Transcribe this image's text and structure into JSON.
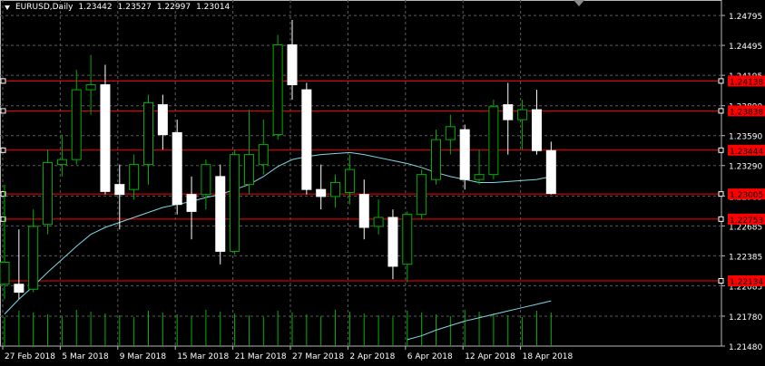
{
  "header": {
    "symbol": "EURUSD,Daily",
    "open": "1.23442",
    "high": "1.23527",
    "low": "1.22997",
    "close": "1.23014"
  },
  "colors": {
    "background": "#000000",
    "grid": "#5c5c5c",
    "candle_up": "#000000",
    "candle_down": "#ffffff",
    "candle_outline": "#00b000",
    "ma_line": "#7fd8e6",
    "level_line": "#ff0000",
    "level_label_bg": "#ff0000",
    "volume": "#00b400",
    "axis_text": "#ffffff"
  },
  "chart_data": {
    "type": "candlestick",
    "ylim": [
      1.2148,
      1.2495
    ],
    "y_ticks": [
      "1.24795",
      "1.24495",
      "1.24195",
      "1.23890",
      "1.23590",
      "1.23290",
      "1.22985",
      "1.22685",
      "1.22385",
      "1.22085",
      "1.21780",
      "1.21480"
    ],
    "x_tick_labels": [
      "27 Feb 2018",
      "5 Mar 2018",
      "9 Mar 2018",
      "15 Mar 2018",
      "21 Mar 2018",
      "27 Mar 2018",
      "2 Apr 2018",
      "6 Apr 2018",
      "12 Apr 2018",
      "18 Apr 2018"
    ],
    "candles": [
      {
        "o": 1.221,
        "h": 1.231,
        "l": 1.2195,
        "c": 1.2232
      },
      {
        "o": 1.221,
        "h": 1.2265,
        "l": 1.2195,
        "c": 1.2202
      },
      {
        "o": 1.2205,
        "h": 1.2285,
        "l": 1.2202,
        "c": 1.2268
      },
      {
        "o": 1.227,
        "h": 1.2345,
        "l": 1.226,
        "c": 1.2332
      },
      {
        "o": 1.233,
        "h": 1.236,
        "l": 1.2318,
        "c": 1.2335
      },
      {
        "o": 1.2335,
        "h": 1.2425,
        "l": 1.233,
        "c": 1.2405
      },
      {
        "o": 1.2405,
        "h": 1.244,
        "l": 1.238,
        "c": 1.241
      },
      {
        "o": 1.241,
        "h": 1.243,
        "l": 1.23,
        "c": 1.2303
      },
      {
        "o": 1.231,
        "h": 1.233,
        "l": 1.2265,
        "c": 1.23
      },
      {
        "o": 1.2305,
        "h": 1.234,
        "l": 1.2295,
        "c": 1.233
      },
      {
        "o": 1.233,
        "h": 1.24,
        "l": 1.231,
        "c": 1.2392
      },
      {
        "o": 1.239,
        "h": 1.24,
        "l": 1.2345,
        "c": 1.236
      },
      {
        "o": 1.2362,
        "h": 1.2375,
        "l": 1.228,
        "c": 1.229
      },
      {
        "o": 1.23,
        "h": 1.2318,
        "l": 1.2255,
        "c": 1.2283
      },
      {
        "o": 1.23,
        "h": 1.2335,
        "l": 1.2285,
        "c": 1.233
      },
      {
        "o": 1.2318,
        "h": 1.233,
        "l": 1.223,
        "c": 1.2243
      },
      {
        "o": 1.2243,
        "h": 1.2345,
        "l": 1.224,
        "c": 1.234
      },
      {
        "o": 1.231,
        "h": 1.2385,
        "l": 1.23,
        "c": 1.234
      },
      {
        "o": 1.233,
        "h": 1.2375,
        "l": 1.232,
        "c": 1.235
      },
      {
        "o": 1.236,
        "h": 1.246,
        "l": 1.2355,
        "c": 1.245
      },
      {
        "o": 1.245,
        "h": 1.2475,
        "l": 1.2395,
        "c": 1.241
      },
      {
        "o": 1.2405,
        "h": 1.2412,
        "l": 1.23,
        "c": 1.2305
      },
      {
        "o": 1.2305,
        "h": 1.233,
        "l": 1.2285,
        "c": 1.2298
      },
      {
        "o": 1.2298,
        "h": 1.232,
        "l": 1.2287,
        "c": 1.2312
      },
      {
        "o": 1.2302,
        "h": 1.234,
        "l": 1.229,
        "c": 1.2325
      },
      {
        "o": 1.23,
        "h": 1.2315,
        "l": 1.2255,
        "c": 1.2267
      },
      {
        "o": 1.2268,
        "h": 1.2295,
        "l": 1.226,
        "c": 1.2277
      },
      {
        "o": 1.2277,
        "h": 1.2285,
        "l": 1.2215,
        "c": 1.2228
      },
      {
        "o": 1.223,
        "h": 1.2283,
        "l": 1.2212,
        "c": 1.228
      },
      {
        "o": 1.228,
        "h": 1.2325,
        "l": 1.2275,
        "c": 1.232
      },
      {
        "o": 1.2315,
        "h": 1.2365,
        "l": 1.231,
        "c": 1.2355
      },
      {
        "o": 1.2355,
        "h": 1.238,
        "l": 1.234,
        "c": 1.2368
      },
      {
        "o": 1.2365,
        "h": 1.237,
        "l": 1.2305,
        "c": 1.2315
      },
      {
        "o": 1.2315,
        "h": 1.2345,
        "l": 1.231,
        "c": 1.232
      },
      {
        "o": 1.232,
        "h": 1.2395,
        "l": 1.2315,
        "c": 1.2388
      },
      {
        "o": 1.239,
        "h": 1.2412,
        "l": 1.234,
        "c": 1.2375
      },
      {
        "o": 1.2375,
        "h": 1.2395,
        "l": 1.2345,
        "c": 1.2385
      },
      {
        "o": 1.2385,
        "h": 1.2405,
        "l": 1.234,
        "c": 1.2344
      },
      {
        "o": 1.2344,
        "h": 1.2353,
        "l": 1.23,
        "c": 1.2301
      }
    ],
    "moving_average": [
      1.218,
      1.2195,
      1.2208,
      1.2222,
      1.2235,
      1.2248,
      1.226,
      1.2267,
      1.2272,
      1.2277,
      1.2282,
      1.2287,
      1.229,
      1.2293,
      1.2297,
      1.23,
      1.2305,
      1.231,
      1.2318,
      1.2328,
      1.2335,
      1.2338,
      1.234,
      1.2341,
      1.2342,
      1.234,
      1.2337,
      1.2334,
      1.2331,
      1.2327,
      1.2322,
      1.2318,
      1.2315,
      1.2312,
      1.2312,
      1.2313,
      1.2314,
      1.2315,
      1.2318
    ],
    "levels": [
      "1.24138",
      "1.23838",
      "1.23444",
      "1.23005",
      "1.22753",
      "1.22134"
    ],
    "volume_ma": [
      null,
      null,
      null,
      null,
      null,
      null,
      null,
      null,
      null,
      null,
      null,
      null,
      null,
      null,
      null,
      null,
      null,
      null,
      null,
      null,
      null,
      null,
      null,
      null,
      null,
      null,
      null,
      null,
      0.05,
      0.12,
      0.22,
      0.3,
      0.38,
      0.44,
      0.5,
      0.56,
      0.62,
      0.68,
      0.74
    ]
  }
}
